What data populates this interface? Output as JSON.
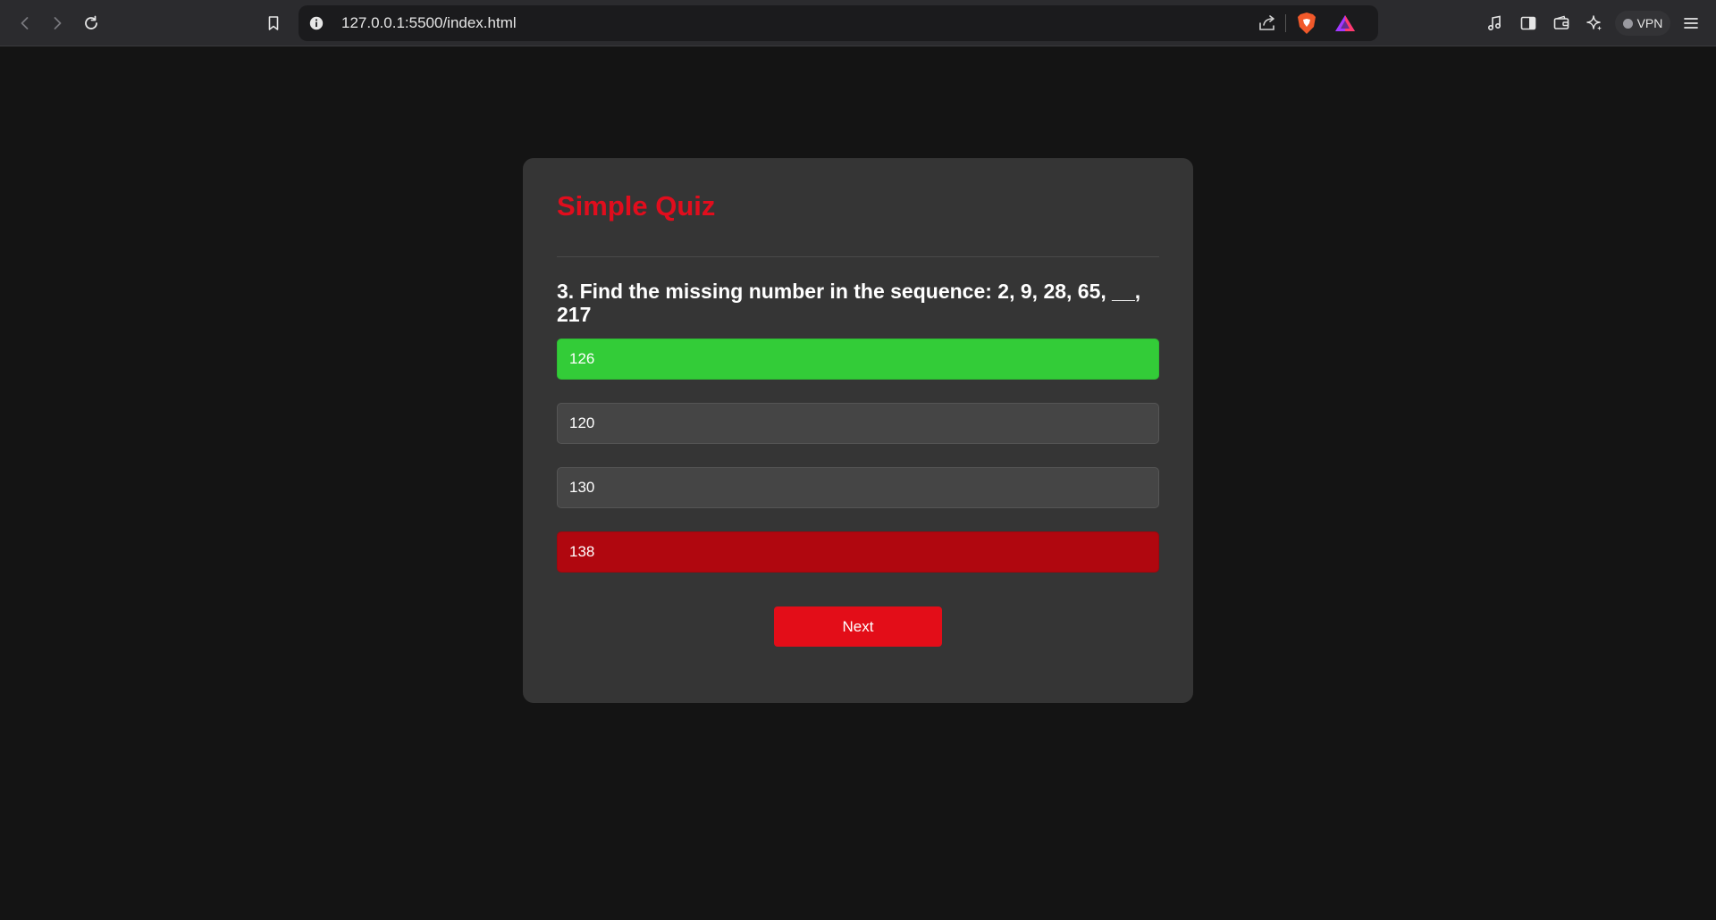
{
  "browser": {
    "url": "127.0.0.1:5500/index.html",
    "vpn_label": "VPN"
  },
  "quiz": {
    "title": "Simple Quiz",
    "question": "3. Find the missing number in the sequence: 2, 9, 28, 65, __, 217",
    "answers": [
      {
        "label": "126",
        "state": "correct"
      },
      {
        "label": "120",
        "state": "neutral"
      },
      {
        "label": "130",
        "state": "neutral"
      },
      {
        "label": "138",
        "state": "incorrect"
      }
    ],
    "next_label": "Next"
  },
  "colors": {
    "accent_red": "#e10d1d",
    "correct_green": "#33cc38",
    "incorrect_red": "#b0070f",
    "card_bg": "#353535",
    "page_bg": "#141414"
  }
}
